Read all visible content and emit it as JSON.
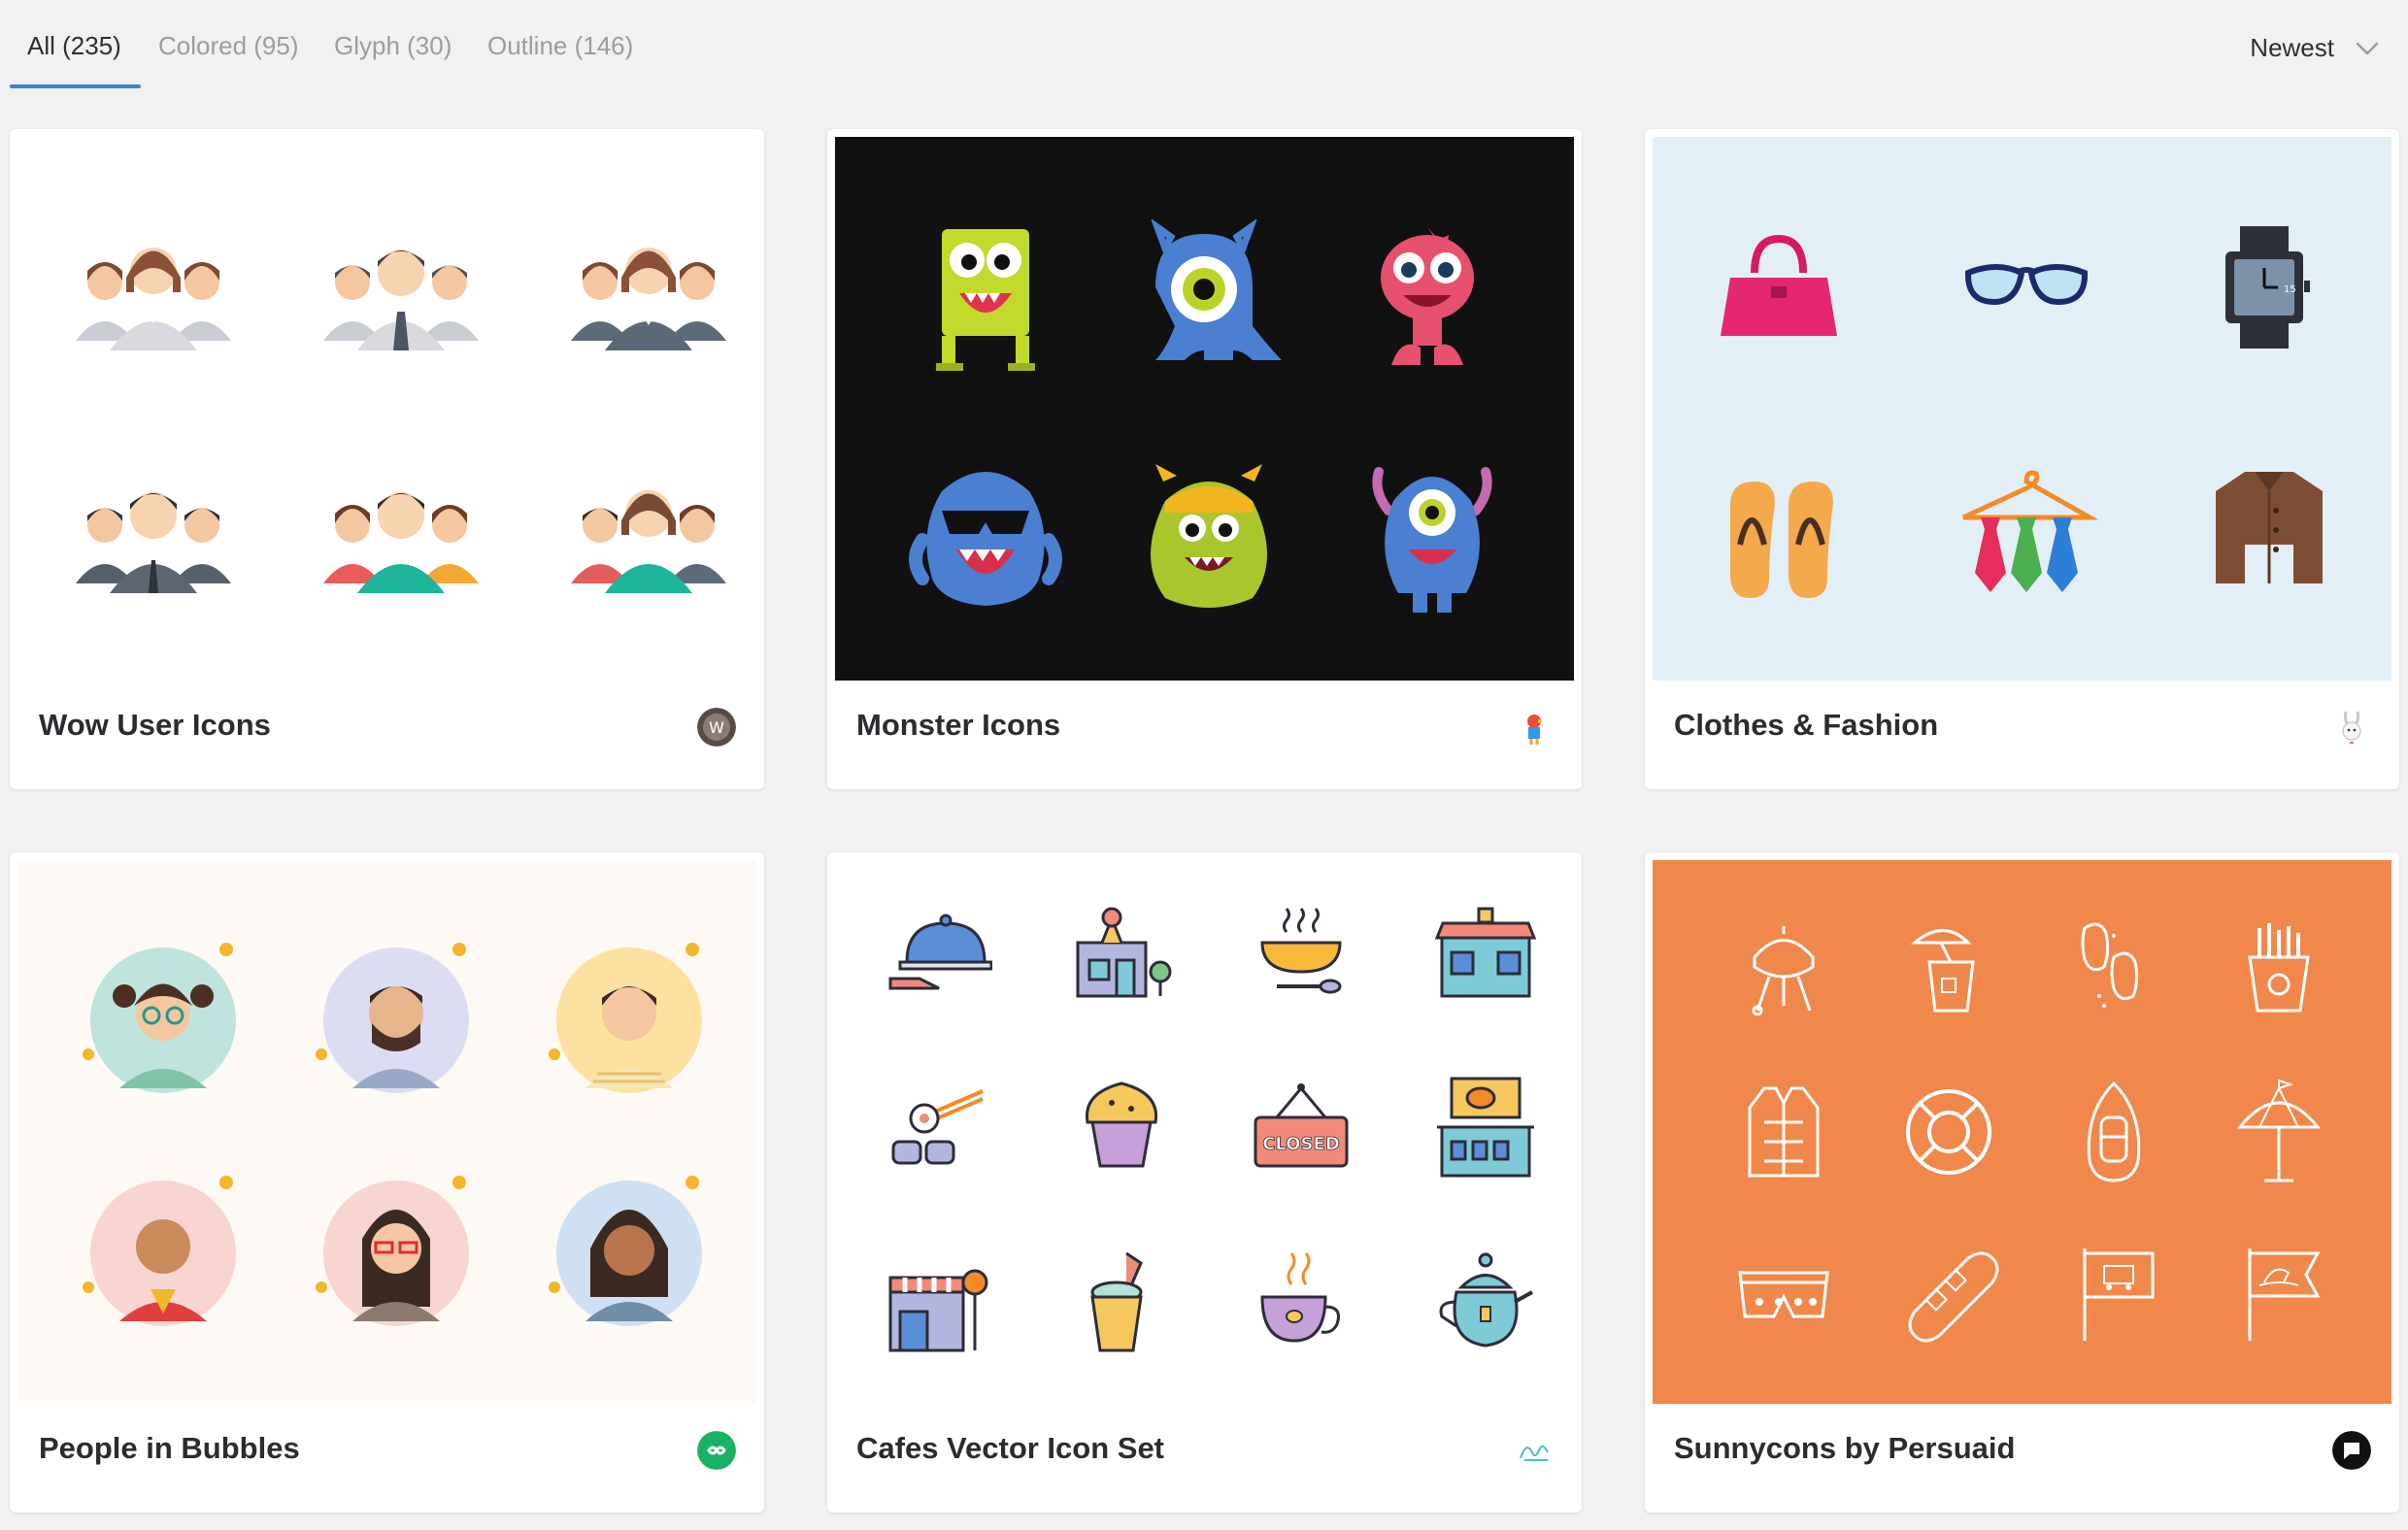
{
  "filter_tabs": [
    {
      "label": "All (235)",
      "active": true
    },
    {
      "label": "Colored (95)",
      "active": false
    },
    {
      "label": "Glyph (30)",
      "active": false
    },
    {
      "label": "Outline (146)",
      "active": false
    }
  ],
  "sort": {
    "label": "Newest"
  },
  "colors": {
    "accent": "#3d7fd8",
    "monster_bg": "#111111",
    "fashion_bg": "#e3eff7",
    "bubbles_bg": "#fdf9f4",
    "sunny_bg": "#f0884b"
  },
  "packs": [
    {
      "title": "Wow User Icons",
      "author_icon": "user-badge-icon"
    },
    {
      "title": "Monster Icons",
      "author_icon": "parrot-avatar-icon"
    },
    {
      "title": "Clothes & Fashion",
      "author_icon": "rabbit-avatar-icon"
    },
    {
      "title": "People in Bubbles",
      "author_icon": "infinity-badge-icon"
    },
    {
      "title": "Cafes Vector Icon Set",
      "author_icon": "signature-logo-icon"
    },
    {
      "title": "Sunnycons by Persuaid",
      "author_icon": "speech-bubble-badge-icon"
    }
  ]
}
